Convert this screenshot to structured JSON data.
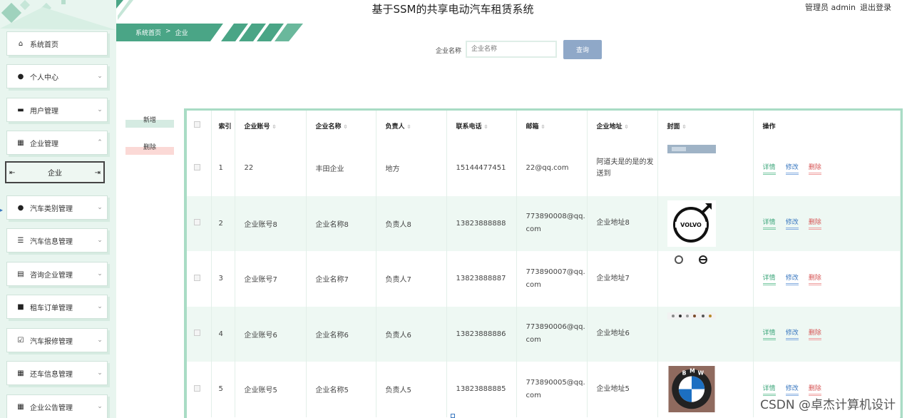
{
  "app": {
    "title": "基于SSM的共享电动汽车租赁系统",
    "user_label": "管理员 admin",
    "logout_label": "退出登录"
  },
  "sidebar": {
    "items": [
      {
        "label": "系统首页",
        "icon": "home-icon",
        "expandable": false
      },
      {
        "label": "个人中心",
        "icon": "user-icon",
        "expandable": true
      },
      {
        "label": "用户管理",
        "icon": "id-card-icon",
        "expandable": true
      },
      {
        "label": "企业管理",
        "icon": "grid-icon",
        "expandable": true,
        "expanded": true
      },
      {
        "label": "汽车类别管理",
        "icon": "pin-icon",
        "expandable": true
      },
      {
        "label": "汽车信息管理",
        "icon": "list-icon",
        "expandable": true
      },
      {
        "label": "咨询企业管理",
        "icon": "clipboard-icon",
        "expandable": true
      },
      {
        "label": "租车订单管理",
        "icon": "shirt-icon",
        "expandable": true
      },
      {
        "label": "汽车报修管理",
        "icon": "check-clipboard-icon",
        "expandable": true
      },
      {
        "label": "还车信息管理",
        "icon": "grid-icon",
        "expandable": true
      },
      {
        "label": "企业公告管理",
        "icon": "grid-icon",
        "expandable": true
      }
    ],
    "submenu": {
      "label": "企业"
    }
  },
  "breadcrumb": {
    "home": "系统首页",
    "separator": ">",
    "current": "企业"
  },
  "search": {
    "label": "企业名称",
    "placeholder": "企业名称",
    "value": "",
    "button": "查询"
  },
  "actions": {
    "add": "新增",
    "delete": "删除"
  },
  "table": {
    "headers": {
      "index": "索引",
      "account": "企业账号",
      "name": "企业名称",
      "person": "负责人",
      "phone": "联系电话",
      "email": "邮箱",
      "address": "企业地址",
      "cover": "封面",
      "ops": "操作"
    },
    "op_labels": {
      "detail": "详情",
      "edit": "修改",
      "delete": "删除"
    },
    "rows": [
      {
        "index": "1",
        "account": "22",
        "name": "丰田企业",
        "person": "地方",
        "phone": "15144477451",
        "email": "22@qq.com",
        "address": "阿道夫是的是的发送到",
        "cover": "blurred-image"
      },
      {
        "index": "2",
        "account": "企业账号8",
        "name": "企业名称8",
        "person": "负责人8",
        "phone": "13823888888",
        "email": "773890008@qq.com",
        "address": "企业地址8",
        "cover": "volvo-logo"
      },
      {
        "index": "3",
        "account": "企业账号7",
        "name": "企业名称7",
        "person": "负责人7",
        "phone": "13823888887",
        "email": "773890007@qq.com",
        "address": "企业地址7",
        "cover": "brand-icons"
      },
      {
        "index": "4",
        "account": "企业账号6",
        "name": "企业名称6",
        "person": "负责人6",
        "phone": "13823888886",
        "email": "773890006@qq.com",
        "address": "企业地址6",
        "cover": "small-logos"
      },
      {
        "index": "5",
        "account": "企业账号5",
        "name": "企业名称5",
        "person": "负责人5",
        "phone": "13823888885",
        "email": "773890005@qq.com",
        "address": "企业地址5",
        "cover": "bmw-logo"
      }
    ]
  },
  "watermark": "CSDN @卓杰计算机设计",
  "colors": {
    "accent": "#4aa586",
    "sidebar_bg": "#e8f5ef",
    "row_alt": "#eef8f3",
    "search_btn": "#8fa8c8"
  }
}
